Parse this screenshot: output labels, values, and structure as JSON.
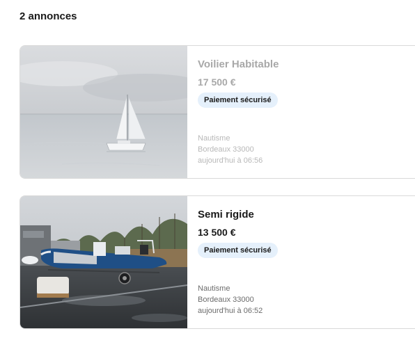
{
  "results": {
    "count_label": "2 annonces"
  },
  "listings": [
    {
      "title": "Voilier Habitable",
      "price": "17 500 €",
      "badge": "Paiement sécurisé",
      "category": "Nautisme",
      "location": "Bordeaux 33000",
      "date": "aujourd'hui à 06:56"
    },
    {
      "title": "Semi rigide",
      "price": "13 500 €",
      "badge": "Paiement sécurisé",
      "category": "Nautisme",
      "location": "Bordeaux 33000",
      "date": "aujourd'hui à 06:52"
    }
  ],
  "colors": {
    "badge_bg": "#e5f0fb",
    "text": "#1a1a1a",
    "muted": "#6b6b6b"
  }
}
